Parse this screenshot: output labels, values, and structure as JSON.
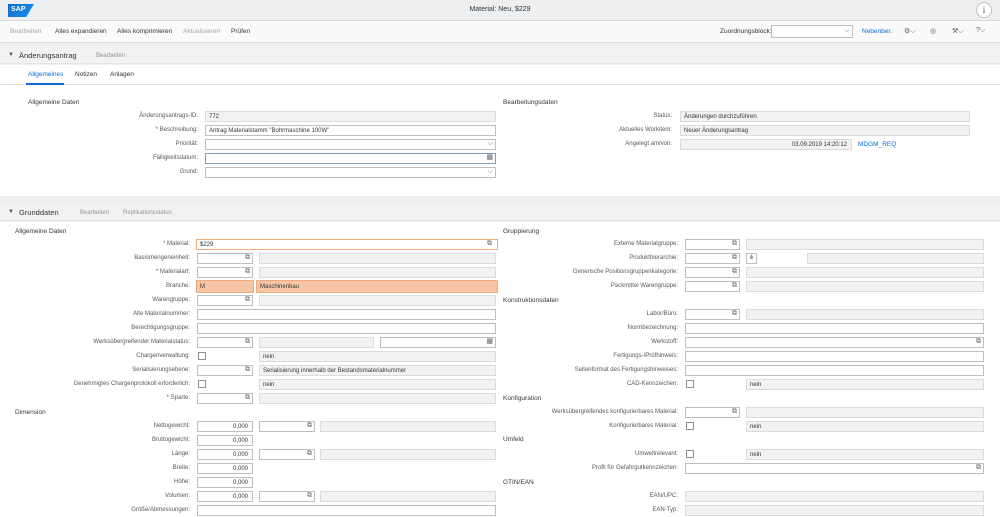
{
  "shell": {
    "logo": "SAP",
    "title": "Material: Neu, $229",
    "help": "i"
  },
  "toolbar": {
    "edit": "Bearbeiten",
    "expand_all": "Alles expandieren",
    "collapse_all": "Alles komprimieren",
    "refresh": "Aktualisieren",
    "check": "Prüfen",
    "assignment_block_label": "Zuordnungsblock:",
    "assignment_block_value": "",
    "side_link": "Nebenber."
  },
  "change_request": {
    "title": "Änderungsantrag",
    "edit": "Bearbeiten",
    "tabs": [
      "Allgemeines",
      "Notizen",
      "Anlagen"
    ],
    "general": {
      "title": "Allgemeine Daten",
      "id_label": "Änderungsantrags-ID:",
      "id_value": "772",
      "desc_label": "* Beschreibung:",
      "desc_value": "Antrag Materialstamm \"Bohrmaschine 100W\"",
      "priority_label": "Priorität:",
      "due_label": "Fälligkeitsdatum:",
      "reason_label": "Grund:"
    },
    "processing": {
      "title": "Bearbeitungsdaten",
      "status_label": "Status:",
      "status_value": "Änderungen durchzuführen",
      "workitem_label": "Aktuelles Workitem:",
      "workitem_value": "Neuer Änderungsantrag",
      "created_label": "Angelegt am/von:",
      "created_value": "03.09.2019 14:20:12",
      "created_by": "MDGM_REQ"
    }
  },
  "basic_data": {
    "title": "Grunddaten",
    "edit": "Bearbeiten",
    "replication": "Replikationsstatus",
    "general": {
      "title": "Allgemeine Daten",
      "material_label": "* Material:",
      "material_value": "$229",
      "base_uom_label": "Basismengeneinheit:",
      "type_label": "* Materialart:",
      "industry_label": "Branche:",
      "industry_code": "M",
      "industry_text": "Maschinenbau",
      "group_label": "Warengruppe:",
      "old_no_label": "Alte Materialnummer:",
      "auth_group_label": "Berechtigungsgruppe:",
      "xplant_status_label": "Werksübergreifender Materialstatus:",
      "batch_label": "Chargenverwaltung:",
      "batch_value": "nein",
      "serial_label": "Serialisierungsebene:",
      "serial_value": "Serialisierung innerhalb der Bestandsmaterialnummer",
      "batch_log_label": "Genehmigtes Chargenprotokoll erforderlich:",
      "batch_log_value": "nein",
      "division_label": "* Sparte:"
    },
    "dimension": {
      "title": "Dimension",
      "net_label": "Nettogewicht:",
      "net_value": "0,000",
      "gross_label": "Bruttogewicht:",
      "gross_value": "0,000",
      "length_label": "Länge:",
      "length_value": "0,000",
      "width_label": "Breite:",
      "width_value": "0,000",
      "height_label": "Höhe:",
      "height_value": "0,000",
      "volume_label": "Volumen:",
      "volume_value": "0,000",
      "size_label": "Größe/Abmessungen:"
    },
    "grouping": {
      "title": "Gruppierung",
      "ext_group_label": "Externe Materialgruppe:",
      "hierarchy_label": "Produkthierarchie:",
      "item_cat_label": "Generische Positionsgruppenkategorie:",
      "pack_group_label": "Packmittel Warengruppe:"
    },
    "design": {
      "title": "Konstruktionsdaten",
      "lab_label": "Labor/Büro:",
      "norm_label": "Normbezeichnung:",
      "material_label": "Werkstoff:",
      "production_label": "Fertigungs-/Prüfhinweis:",
      "page_format_label": "Seitenformat des Fertigungshinweises:",
      "cad_label": "CAD-Kennzeichen:",
      "cad_value": "nein"
    },
    "config": {
      "title": "Konfiguration",
      "xplant_conf_label": "Werksübergreifendes konfigurierbares Material:",
      "conf_label": "Konfigurierbares Material:",
      "conf_value": "nein"
    },
    "environment": {
      "title": "Umfeld",
      "env_label": "Umweltrelevant:",
      "env_value": "nein",
      "hazard_label": "Profil für Gefahrgutkennzeichen:"
    },
    "gtin": {
      "title": "GTIN/EAN",
      "ean_label": "EAN/UPC:",
      "ean_type_label": "EAN-Typ:"
    }
  },
  "colors": {
    "accent": "#0a6ed1",
    "highlight": "#f5c5a5",
    "highlight_border": "#f0ab7a"
  }
}
